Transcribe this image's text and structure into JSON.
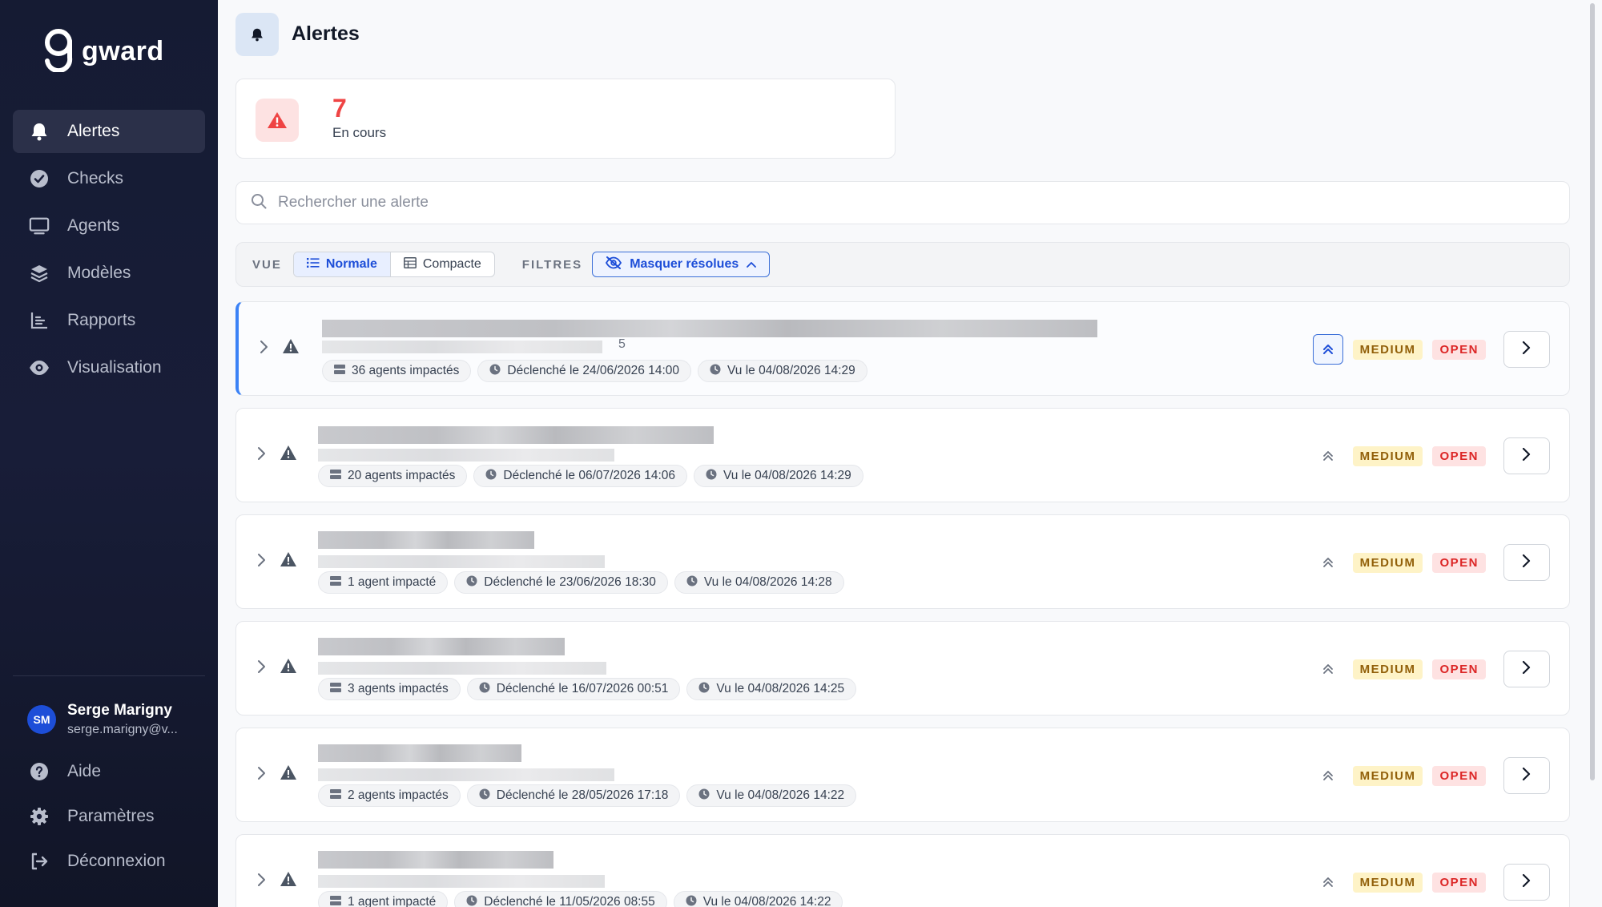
{
  "app": {
    "logo_text": "gward"
  },
  "sidebar": {
    "items": [
      {
        "label": "Alertes",
        "icon": "bell-icon",
        "active": true
      },
      {
        "label": "Checks",
        "icon": "check-circle-icon"
      },
      {
        "label": "Agents",
        "icon": "monitor-icon"
      },
      {
        "label": "Modèles",
        "icon": "layers-icon"
      },
      {
        "label": "Rapports",
        "icon": "bar-chart-icon"
      },
      {
        "label": "Visualisation",
        "icon": "eye-icon"
      }
    ],
    "user": {
      "initials": "SM",
      "name": "Serge Marigny",
      "email": "serge.marigny@v..."
    },
    "bottom": [
      {
        "label": "Aide",
        "icon": "help-circle-icon"
      },
      {
        "label": "Paramètres",
        "icon": "gear-icon"
      },
      {
        "label": "Déconnexion",
        "icon": "logout-icon"
      }
    ]
  },
  "header": {
    "title": "Alertes"
  },
  "stats": {
    "count": "7",
    "label": "En cours"
  },
  "search": {
    "placeholder": "Rechercher une alerte",
    "value": ""
  },
  "toolbar": {
    "view_label": "VUE",
    "view_normal": "Normale",
    "view_compact": "Compacte",
    "filters_label": "FILTRES",
    "filter_hide_resolved": "Masquer résolues"
  },
  "colors": {
    "accent": "#1d4ed8",
    "danger": "#ef4444",
    "sidebar_bg": "#151b33"
  },
  "alerts": [
    {
      "agents": "36 agents impactés",
      "triggered": "Déclenché le 24/06/2026 14:00",
      "seen": "Vu le 04/08/2026 14:29",
      "severity": "MEDIUM",
      "status": "OPEN",
      "subtitle_fragment": "5"
    },
    {
      "agents": "20 agents impactés",
      "triggered": "Déclenché le 06/07/2026 14:06",
      "seen": "Vu le 04/08/2026 14:29",
      "severity": "MEDIUM",
      "status": "OPEN"
    },
    {
      "agents": "1 agent impacté",
      "triggered": "Déclenché le 23/06/2026 18:30",
      "seen": "Vu le 04/08/2026 14:28",
      "severity": "MEDIUM",
      "status": "OPEN"
    },
    {
      "agents": "3 agents impactés",
      "triggered": "Déclenché le 16/07/2026 00:51",
      "seen": "Vu le 04/08/2026 14:25",
      "severity": "MEDIUM",
      "status": "OPEN"
    },
    {
      "agents": "2 agents impactés",
      "triggered": "Déclenché le 28/05/2026 17:18",
      "seen": "Vu le 04/08/2026 14:22",
      "severity": "MEDIUM",
      "status": "OPEN"
    },
    {
      "agents": "1 agent impacté",
      "triggered": "Déclenché le 11/05/2026 08:55",
      "seen": "Vu le 04/08/2026 14:22",
      "severity": "MEDIUM",
      "status": "OPEN"
    }
  ]
}
